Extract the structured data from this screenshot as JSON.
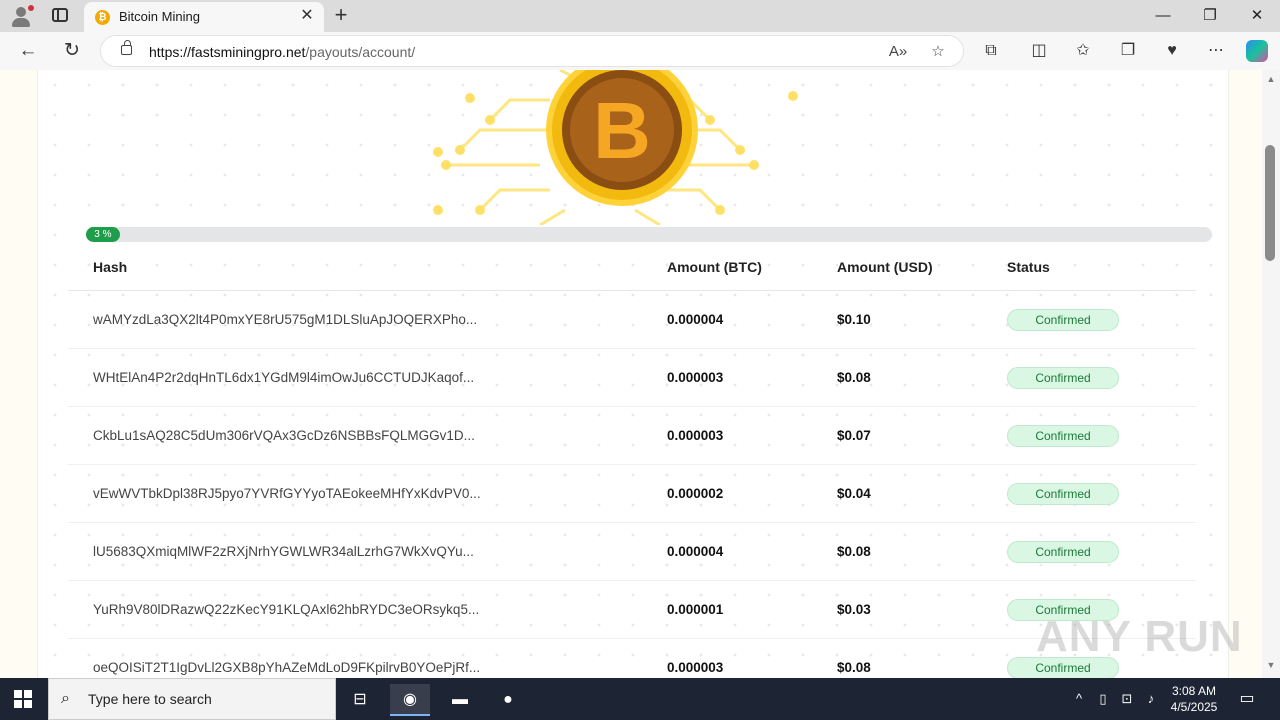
{
  "browser": {
    "tab_title": "Bitcoin Mining",
    "tab_favicon": "₿",
    "new_tab": "+",
    "url_host": "https://fastsminingpro.net",
    "url_path": "/payouts/account/",
    "window_controls": {
      "minimize": "—",
      "restore": "❐",
      "close": "✕"
    }
  },
  "page": {
    "progress": {
      "label": "3 %",
      "value_percent": 3
    },
    "table": {
      "headers": {
        "hash": "Hash",
        "btc": "Amount (BTC)",
        "usd": "Amount (USD)",
        "status": "Status"
      },
      "rows": [
        {
          "hash": "wAMYzdLa3QX2lt4P0mxYE8rU575gM1DLSluApJOQERXPho...",
          "btc": "0.000004",
          "usd": "$0.10",
          "status": "Confirmed"
        },
        {
          "hash": "WHtElAn4P2r2dqHnTL6dx1YGdM9l4imOwJu6CCTUDJKaqof...",
          "btc": "0.000003",
          "usd": "$0.08",
          "status": "Confirmed"
        },
        {
          "hash": "CkbLu1sAQ28C5dUm306rVQAx3GcDz6NSBBsFQLMGGv1D...",
          "btc": "0.000003",
          "usd": "$0.07",
          "status": "Confirmed"
        },
        {
          "hash": "vEwWVTbkDpl38RJ5pyo7YVRfGYYyoTAEokeeMHfYxKdvPV0...",
          "btc": "0.000002",
          "usd": "$0.04",
          "status": "Confirmed"
        },
        {
          "hash": "lU5683QXmiqMlWF2zRXjNrhYGWLWR34alLzrhG7WkXvQYu...",
          "btc": "0.000004",
          "usd": "$0.08",
          "status": "Confirmed"
        },
        {
          "hash": "YuRh9V80lDRazwQ22zKecY91KLQAxl62hbRYDC3eORsykq5...",
          "btc": "0.000001",
          "usd": "$0.03",
          "status": "Confirmed"
        },
        {
          "hash": "oeQOISiT2T1IgDvLl2GXB8pYhAZeMdLoD9FKpilrvB0YOePjRf...",
          "btc": "0.000003",
          "usd": "$0.08",
          "status": "Confirmed"
        }
      ]
    },
    "watermark": "ANY RUN"
  },
  "taskbar": {
    "search_placeholder": "Type here to search",
    "time": "3:08 AM",
    "date": "4/5/2025"
  },
  "colors": {
    "accent_green": "#1e9e4a",
    "badge_bg": "#d9f7e2",
    "coin_gold": "#f2a900"
  }
}
